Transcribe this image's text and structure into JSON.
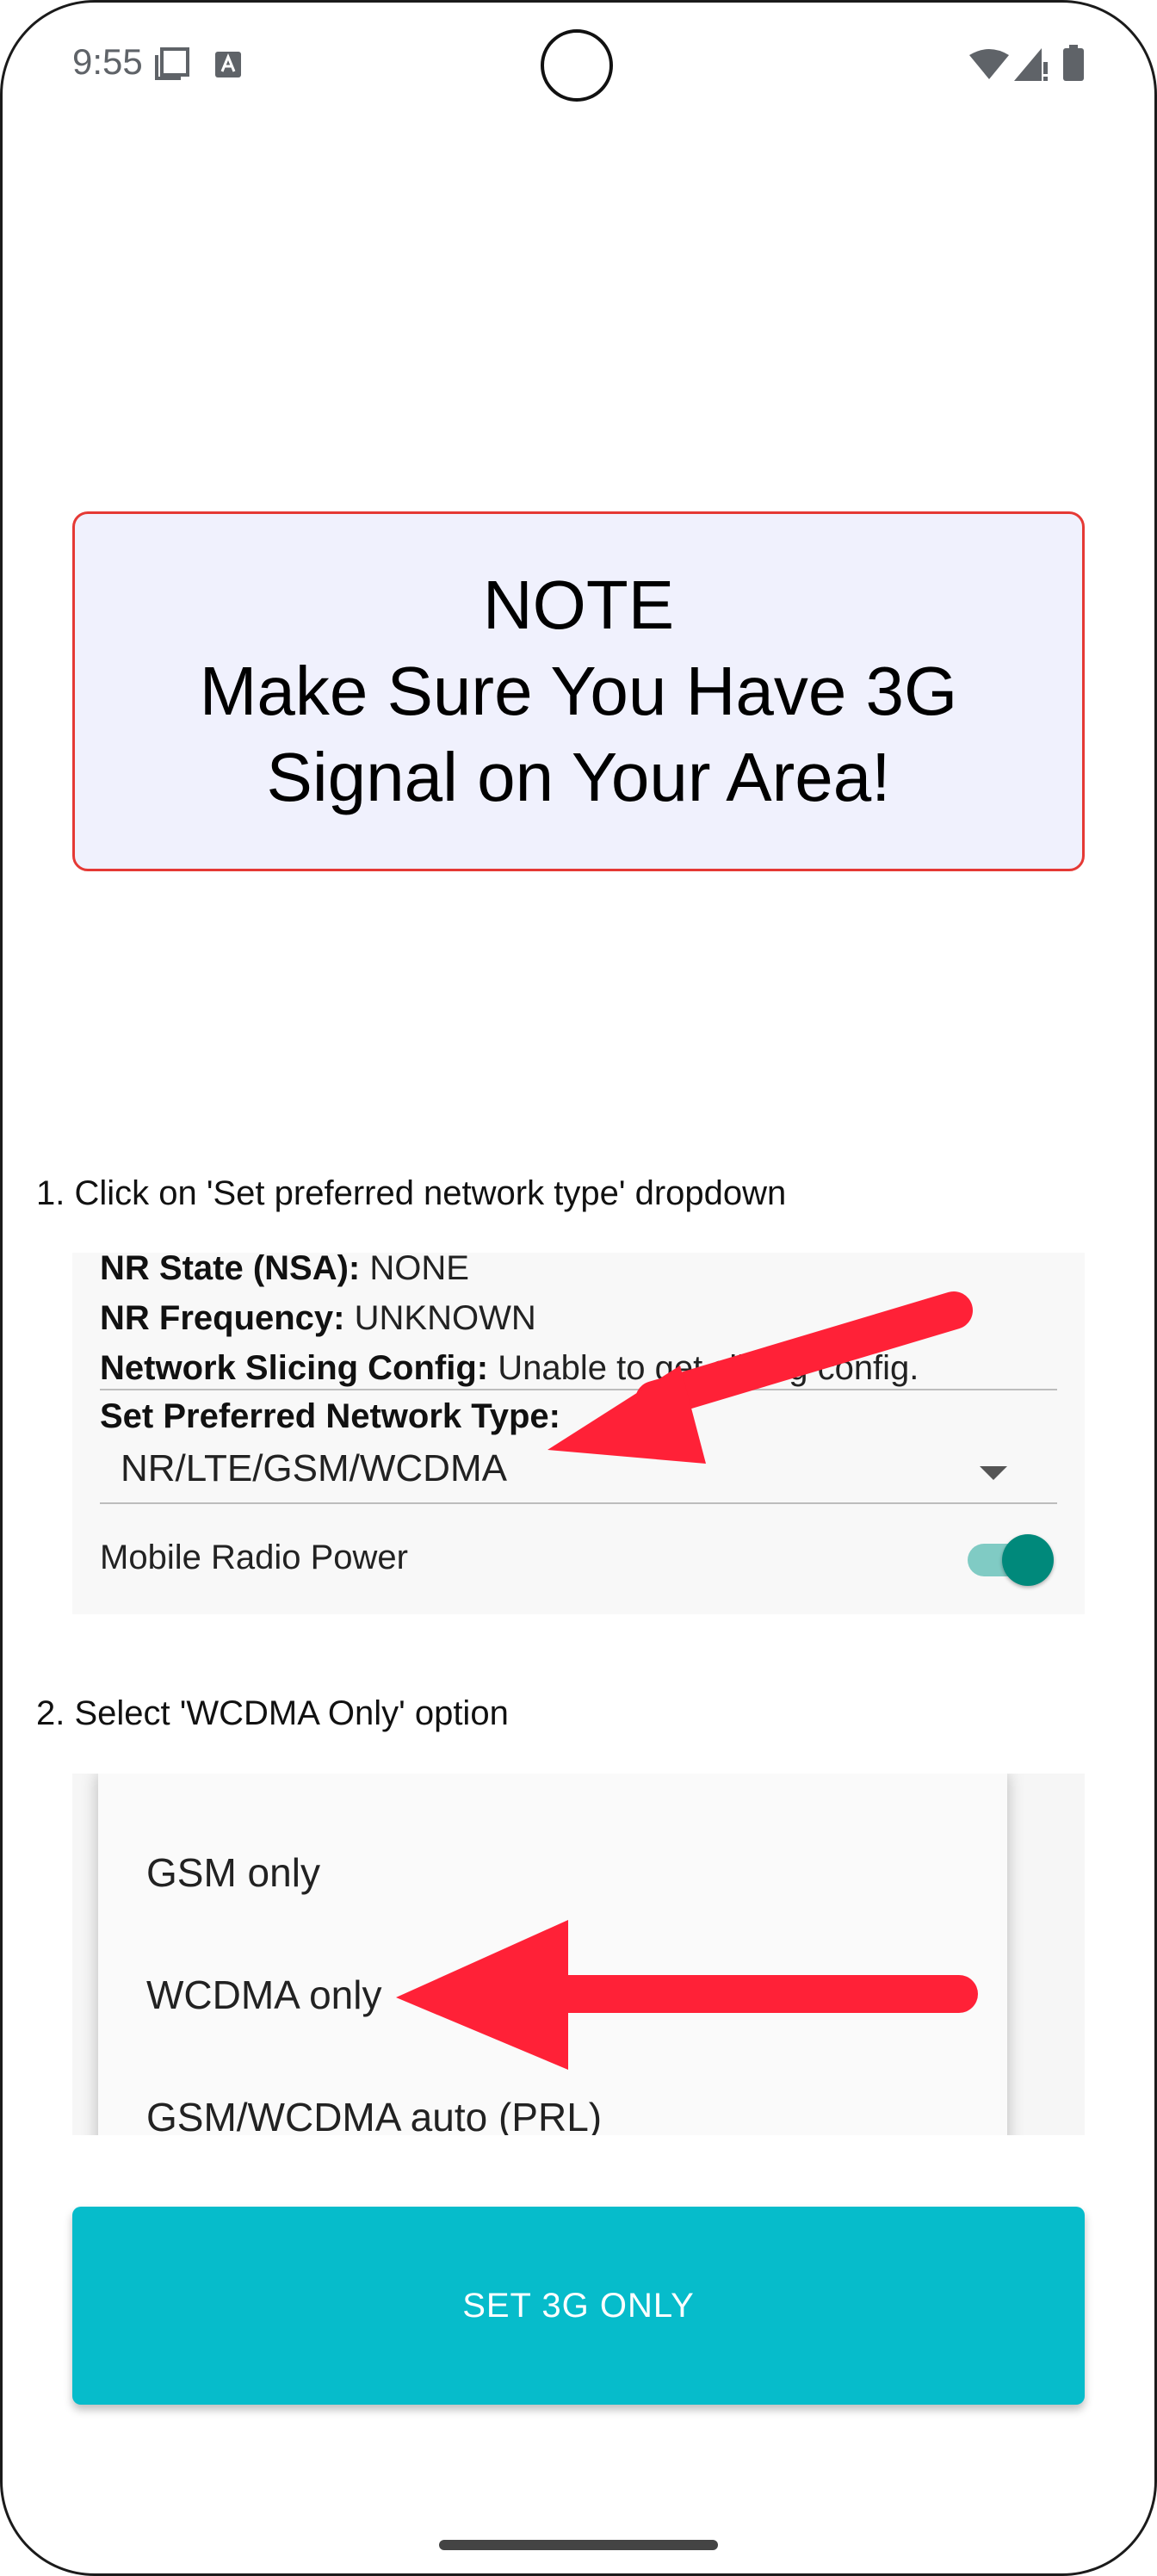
{
  "status_bar": {
    "time": "9:55",
    "icons": [
      "screenshot-icon",
      "a-notification-icon",
      "wifi-icon",
      "signal-icon",
      "battery-icon"
    ]
  },
  "note": {
    "lines": [
      "NOTE",
      "Make Sure You Have 3G",
      "Signal on Your Area!"
    ],
    "border_color": "#e53935",
    "background": "#f0f1fd"
  },
  "steps": {
    "step1": "1. Click on 'Set preferred network type' dropdown",
    "step2": "2. Select 'WCDMA Only' option"
  },
  "screenshot1": {
    "nr_state_label": "NR State (NSA):",
    "nr_state_value": " NONE",
    "nr_frequency_label": "NR Frequency:",
    "nr_frequency_value": " UNKNOWN",
    "slicing_label": "Network Slicing Config:",
    "slicing_value": " Unable to get slicing config.",
    "preferred_label": "Set Preferred Network Type:",
    "preferred_value": "NR/LTE/GSM/WCDMA",
    "radio_power_label": "Mobile Radio Power",
    "radio_power_on": true
  },
  "screenshot2": {
    "options": [
      "GSM only",
      "WCDMA only",
      "GSM/WCDMA auto (PRL)"
    ]
  },
  "action_button": {
    "label": "SET 3G ONLY",
    "color": "#06bccb"
  },
  "arrow_color": "#ff2137"
}
